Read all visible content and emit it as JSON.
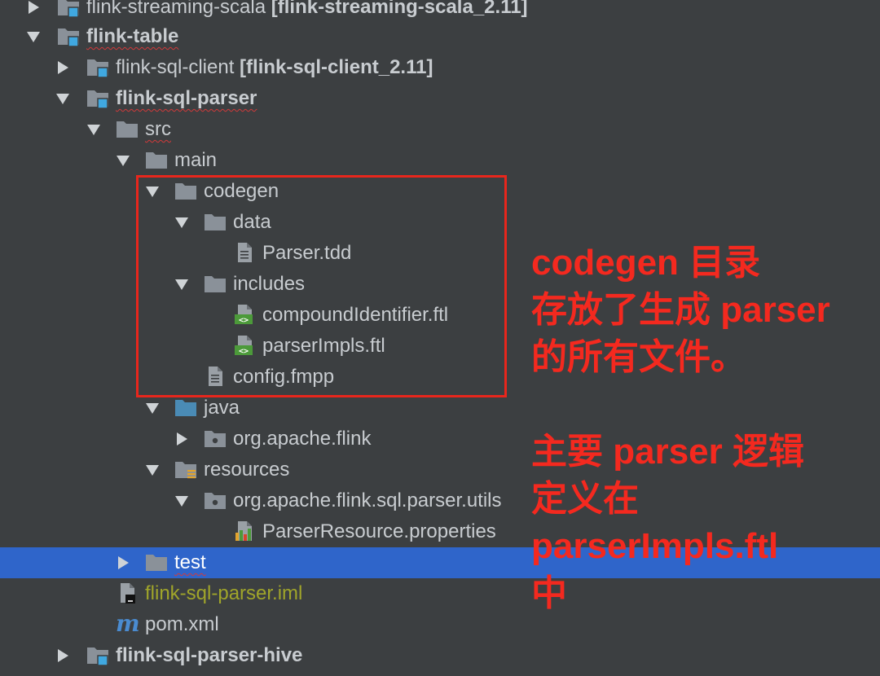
{
  "tree": {
    "streaming_scala": {
      "name": "flink-streaming-scala",
      "bracket": "[flink-streaming-scala_2.11]"
    },
    "flink_table": {
      "name": "flink-table"
    },
    "sql_client": {
      "name": "flink-sql-client",
      "bracket": "[flink-sql-client_2.11]"
    },
    "sql_parser": {
      "name": "flink-sql-parser"
    },
    "src": {
      "name": "src"
    },
    "main": {
      "name": "main"
    },
    "codegen": {
      "name": "codegen"
    },
    "data": {
      "name": "data"
    },
    "parser_tdd": {
      "name": "Parser.tdd"
    },
    "includes": {
      "name": "includes"
    },
    "compound_identifier": {
      "name": "compoundIdentifier.ftl"
    },
    "parser_impls": {
      "name": "parserImpls.ftl"
    },
    "config_fmpp": {
      "name": "config.fmpp"
    },
    "java": {
      "name": "java"
    },
    "org_apache_flink": {
      "name": "org.apache.flink"
    },
    "resources": {
      "name": "resources"
    },
    "parser_utils": {
      "name": "org.apache.flink.sql.parser.utils"
    },
    "parser_resource": {
      "name": "ParserResource.properties"
    },
    "test": {
      "name": "test"
    },
    "parser_iml": {
      "name": "flink-sql-parser.iml"
    },
    "pom": {
      "name": "pom.xml"
    },
    "parser_hive": {
      "name": "flink-sql-parser-hive"
    }
  },
  "annotations": {
    "line1": "codegen 目录",
    "line2": "存放了生成 parser",
    "line3": "的所有文件。",
    "line4": "主要 parser 逻辑",
    "line5": "定义在",
    "line6": "parserImpls.ftl",
    "line7": "中"
  },
  "colors": {
    "background": "#3c3f41",
    "selection": "#2f65ca",
    "annotation_red": "#f4291f",
    "folder_gray": "#8a9199",
    "module_blue": "#40a8e0",
    "source_folder_blue": "#4a8bb5",
    "template_green": "#4c9a3a"
  }
}
